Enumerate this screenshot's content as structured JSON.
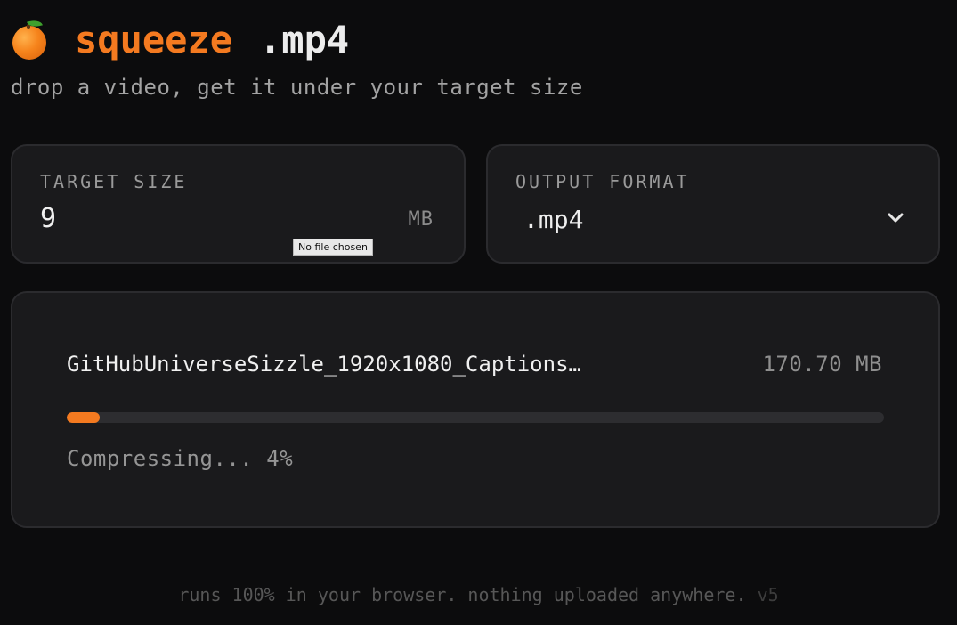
{
  "header": {
    "icon": "orange-emoji",
    "app_name": "squeeze",
    "extension": ".mp4",
    "tagline": "drop a video, get it under your target size"
  },
  "target_size": {
    "label": "TARGET SIZE",
    "value": "9",
    "unit": "MB"
  },
  "file_input": {
    "tooltip": "No file chosen"
  },
  "output_format": {
    "label": "OUTPUT FORMAT",
    "selected": ".mp4",
    "icon": "chevron-down-icon"
  },
  "job": {
    "file_name": "GitHubUniverseSizzle_1920x1080_Captions…",
    "file_size": "170.70 MB",
    "progress": 0.04,
    "status": "Compressing... 4%"
  },
  "footer": {
    "text": "runs 100% in your browser. nothing uploaded anywhere.",
    "version": "v5"
  },
  "colors": {
    "accent": "#f47a20",
    "background": "#0c0c0d",
    "card": "#1a1a1c"
  }
}
